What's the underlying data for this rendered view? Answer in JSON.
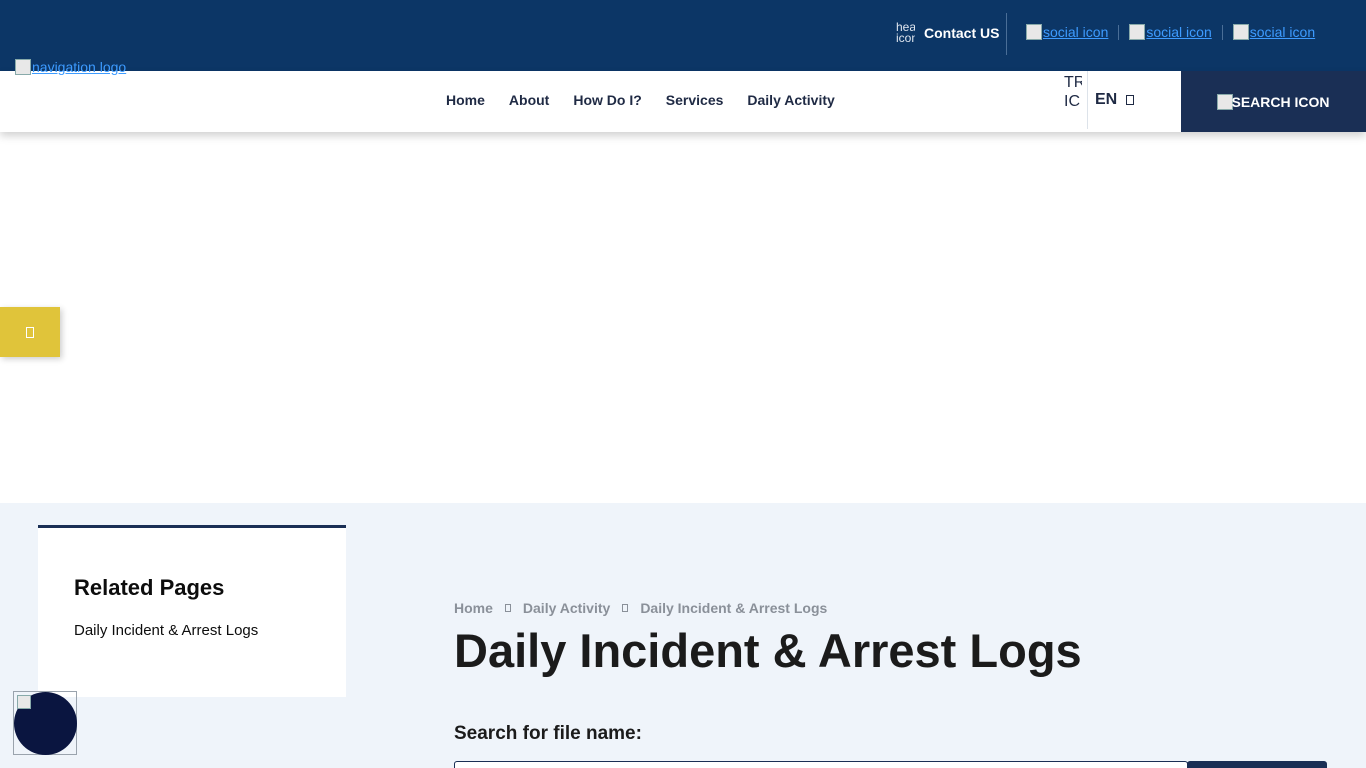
{
  "topbar": {
    "contact_icon_alt": "header icon",
    "contact_label": "Contact US",
    "social_links": [
      {
        "label": "social icon"
      },
      {
        "label": "social icon"
      },
      {
        "label": "social icon"
      }
    ]
  },
  "navbar": {
    "logo_alt": "navigation logo",
    "menu": [
      {
        "label": "Home"
      },
      {
        "label": "About"
      },
      {
        "label": "How Do I?"
      },
      {
        "label": "Services"
      },
      {
        "label": "Daily Activity"
      }
    ],
    "translate_icon_alt": "TR IC",
    "language": "EN",
    "search_button_label": "SEARCH ICON"
  },
  "sidebar": {
    "title": "Related Pages",
    "links": [
      {
        "label": "Daily Incident & Arrest Logs"
      }
    ]
  },
  "breadcrumb": [
    {
      "label": "Home"
    },
    {
      "label": "Daily Activity"
    },
    {
      "label": "Daily Incident & Arrest Logs"
    }
  ],
  "main": {
    "title": "Daily Incident & Arrest Logs",
    "search_label": "Search for file name:"
  },
  "colors": {
    "topbar": "#0c3666",
    "navy": "#1a2f55",
    "accent_yellow": "#e0c43a",
    "content_bg": "#eff4fa",
    "link_blue": "#3d9bff"
  }
}
